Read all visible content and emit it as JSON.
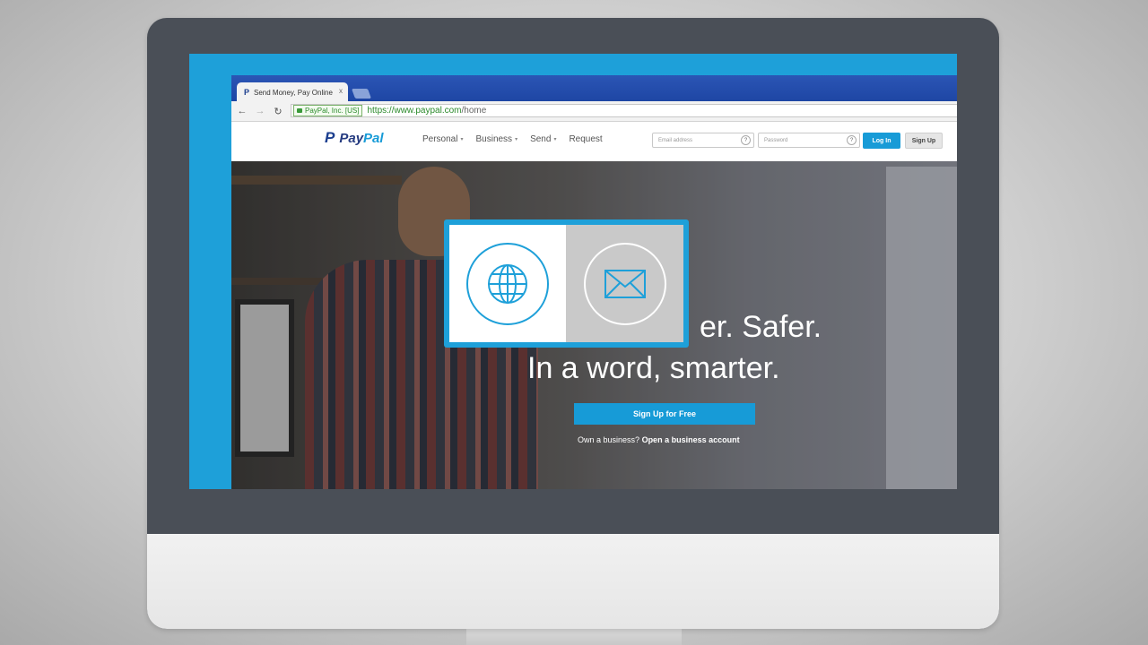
{
  "browser": {
    "tab_title": "Send Money, Pay Online",
    "tab_close": "x",
    "ev_badge": "PayPal, Inc. [US]",
    "url_scheme_host": "https://www.paypal.com",
    "url_path": "/home"
  },
  "header": {
    "logo_mark": "P",
    "logo_pay": "Pay",
    "logo_pal": "Pal",
    "nav": [
      {
        "label": "Personal",
        "caret": "▾"
      },
      {
        "label": "Business",
        "caret": "▾"
      },
      {
        "label": "Send",
        "caret": "▾"
      },
      {
        "label": "Request",
        "caret": ""
      }
    ],
    "email_placeholder": "Email address",
    "password_placeholder": "Password",
    "help_glyph": "?",
    "login_label": "Log In",
    "signup_label": "Sign Up"
  },
  "hero": {
    "headline_line1_visible": "er. Safer.",
    "headline_line2": "In a word, smarter.",
    "cta_label": "Sign Up for Free",
    "business_prompt": "Own a business?",
    "business_link": "Open a business account"
  },
  "overlay": {
    "left_icon": "globe-icon",
    "right_icon": "envelope-icon"
  },
  "colors": {
    "accent": "#179bd7",
    "screen_frame": "#1ea0d9",
    "monitor_bezel": "#4a4f57",
    "paypal_navy": "#253b80"
  }
}
